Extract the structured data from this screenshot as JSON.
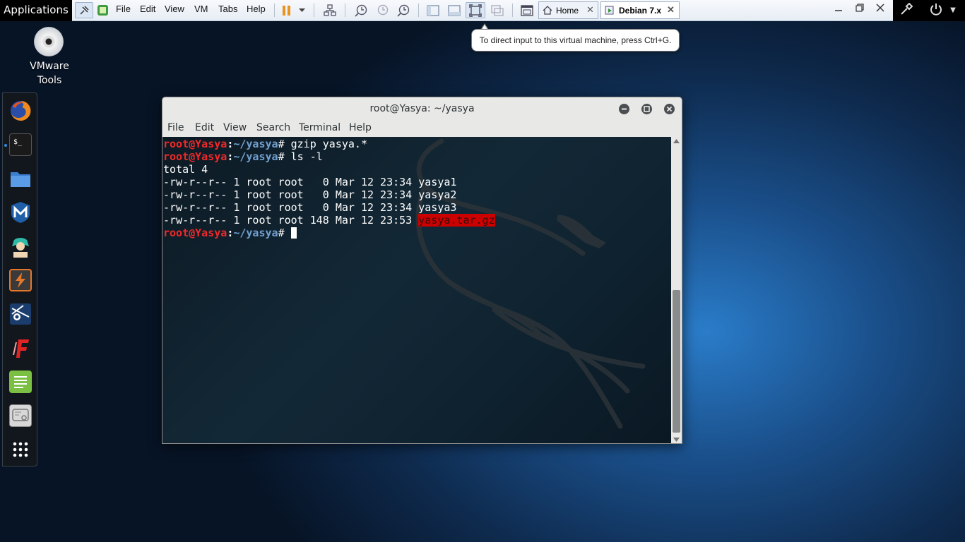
{
  "gnome": {
    "applications_label": "Applications"
  },
  "vmware": {
    "menus": [
      "File",
      "Edit",
      "View",
      "VM",
      "Tabs",
      "Help"
    ],
    "tabs": [
      {
        "label": "Home"
      },
      {
        "label": "Debian 7.x"
      }
    ],
    "close_glyph": "✕"
  },
  "tooltip": {
    "text": "To direct input to this virtual machine, press Ctrl+G."
  },
  "desktop": {
    "icon_label_line1": "VMware",
    "icon_label_line2": "Tools"
  },
  "dock": {
    "items": [
      "firefox-icon",
      "terminal-icon",
      "files-icon",
      "metasploit-icon",
      "armitage-icon",
      "burpsuite-icon",
      "maltego-icon",
      "faraday-icon",
      "leafpad-icon",
      "cherrytree-icon",
      "show-apps-icon"
    ]
  },
  "terminal": {
    "title": "root@Yasya: ~/yasya",
    "menus": [
      "File",
      "Edit",
      "View",
      "Search",
      "Terminal",
      "Help"
    ],
    "prompt_user": "root@Yasya",
    "prompt_colon": ":",
    "prompt_path": "~/yasya",
    "prompt_symbol": "# ",
    "cmd1": "gzip yasya.*",
    "cmd2": "ls -l",
    "total": "total 4",
    "ls_rows": [
      "-rw-r--r-- 1 root root   0 Mar 12 23:34 yasya1",
      "-rw-r--r-- 1 root root   0 Mar 12 23:34 yasya2",
      "-rw-r--r-- 1 root root   0 Mar 12 23:34 yasya3"
    ],
    "ls_row4_prefix": "-rw-r--r-- 1 root root 148 Mar 12 23:53 ",
    "ls_row4_file": "yasya.tar.gz"
  },
  "colors": {
    "prompt_user": "#ef2929",
    "prompt_path": "#729fcf",
    "archive_highlight": "#cc0000"
  }
}
